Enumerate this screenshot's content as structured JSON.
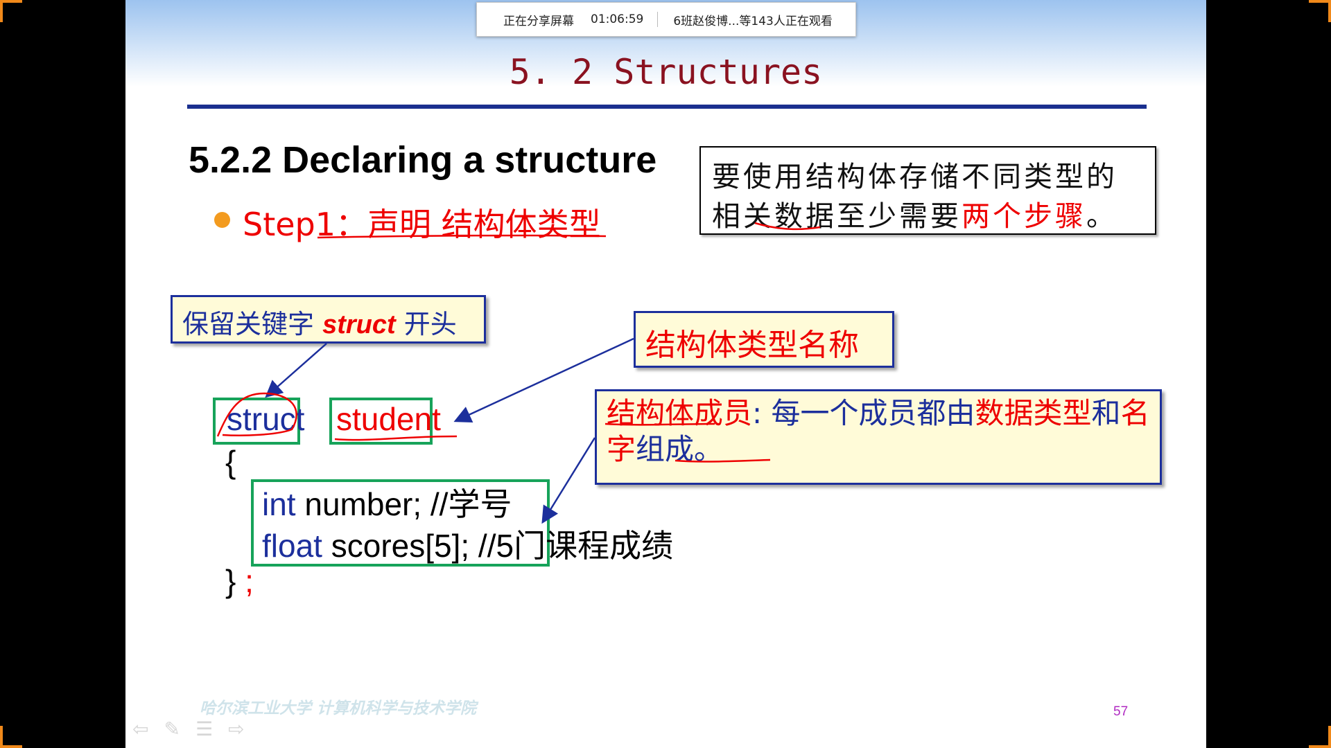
{
  "share_bar": {
    "status": "正在分享屏幕",
    "elapsed": "01:06:59",
    "viewers": "6班赵俊博...等143人正在观看"
  },
  "slide": {
    "title": "5. 2  Structures",
    "heading": "5.2.2 Declaring a structure",
    "step1": "Step1：声明 结构体类型",
    "note": {
      "text_before": "要使用结构体存储不同类型的相关数据至少需要",
      "text_red": "两个步骤",
      "text_after": "。"
    },
    "callout_keyword": {
      "prefix": "保留关键字 ",
      "keyword": "struct",
      "suffix": " 开头"
    },
    "callout_name": "结构体类型名称",
    "callout_members": {
      "part1_red": "结构体成员",
      "part2": ": 每一个成员都由",
      "part3_red": "数据类型",
      "part4": "和",
      "part5_red": "名字",
      "part6": "组成。"
    },
    "code": {
      "struct_kw": "struct",
      "type_name": "student",
      "open_brace": "{",
      "line1_type": "int",
      "line1_rest": " number;   //学号",
      "line2_type": "float",
      "line2_rest": " scores[5];    //5门课程成绩",
      "close_brace": "}",
      "semicolon": ";"
    },
    "footer_brand": "哈尔滨工业大学 计算机科学与技术学院",
    "page_number": "57"
  },
  "colors": {
    "title": "#8a1220",
    "accent_red": "#e00000",
    "callout_border": "#1c2f9c",
    "code_box": "#17a35a",
    "bullet": "#f39b1f"
  },
  "icons": [
    "arrow-left-icon",
    "pen-icon",
    "menu-icon",
    "arrow-right-icon"
  ]
}
